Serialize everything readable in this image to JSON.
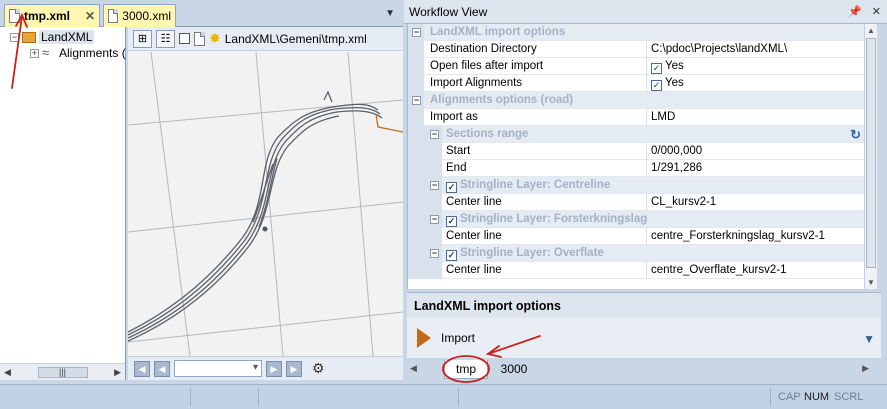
{
  "doc_tabs": [
    {
      "label": "tmp.xml",
      "active": true,
      "close": "✕"
    },
    {
      "label": "3000.xml",
      "active": false
    }
  ],
  "tree": {
    "root_label": "LandXML",
    "child_label": "Alignments ("
  },
  "view": {
    "path": "LandXML\\Gemeni\\tmp.xml"
  },
  "workflow": {
    "title": "Workflow View",
    "rows": [
      {
        "type": "cat",
        "name": "LandXML import options",
        "indent": 1
      },
      {
        "type": "prop",
        "name": "Destination Directory",
        "value": "C:\\pdoc\\Projects\\landXML\\",
        "indent": 1
      },
      {
        "type": "prop",
        "name": "Open files after import",
        "value": "Yes",
        "checked": true,
        "indent": 1
      },
      {
        "type": "prop",
        "name": "Import Alignments",
        "value": "Yes",
        "checked": true,
        "indent": 1
      },
      {
        "type": "cat",
        "name": "Alignments options (road)",
        "indent": 1
      },
      {
        "type": "prop",
        "name": "Import as",
        "value": "LMD",
        "indent": 1
      },
      {
        "type": "cat",
        "name": "Sections range",
        "indent": 2,
        "refresh": true
      },
      {
        "type": "prop",
        "name": "Start",
        "value": "0/000,000",
        "indent": 2
      },
      {
        "type": "prop",
        "name": "End",
        "value": "1/291,286",
        "indent": 2
      },
      {
        "type": "cat",
        "name": "Stringline Layer: Centreline",
        "indent": 2,
        "checked": true
      },
      {
        "type": "prop",
        "name": "Center line",
        "value": "CL_kursv2-1",
        "indent": 2
      },
      {
        "type": "cat",
        "name": "Stringline Layer: Forsterkningslag",
        "indent": 2,
        "checked": true
      },
      {
        "type": "prop",
        "name": "Center line",
        "value": "centre_Forsterkningslag_kursv2-1",
        "indent": 2
      },
      {
        "type": "cat",
        "name": "Stringline Layer: Overflate",
        "indent": 2,
        "checked": true
      },
      {
        "type": "prop",
        "name": "Center line",
        "value": "centre_Overflate_kursv2-1",
        "indent": 2
      }
    ],
    "description_title": "LandXML import options",
    "action_label": "Import",
    "tabs": [
      "tmp",
      "3000"
    ]
  },
  "status": {
    "cap": "CAP",
    "num": "NUM",
    "scrl": "SCRL"
  },
  "colors": {
    "annotation": "#cc1f1f",
    "route": "#5a6068",
    "accent_orange": "#c46a16"
  }
}
